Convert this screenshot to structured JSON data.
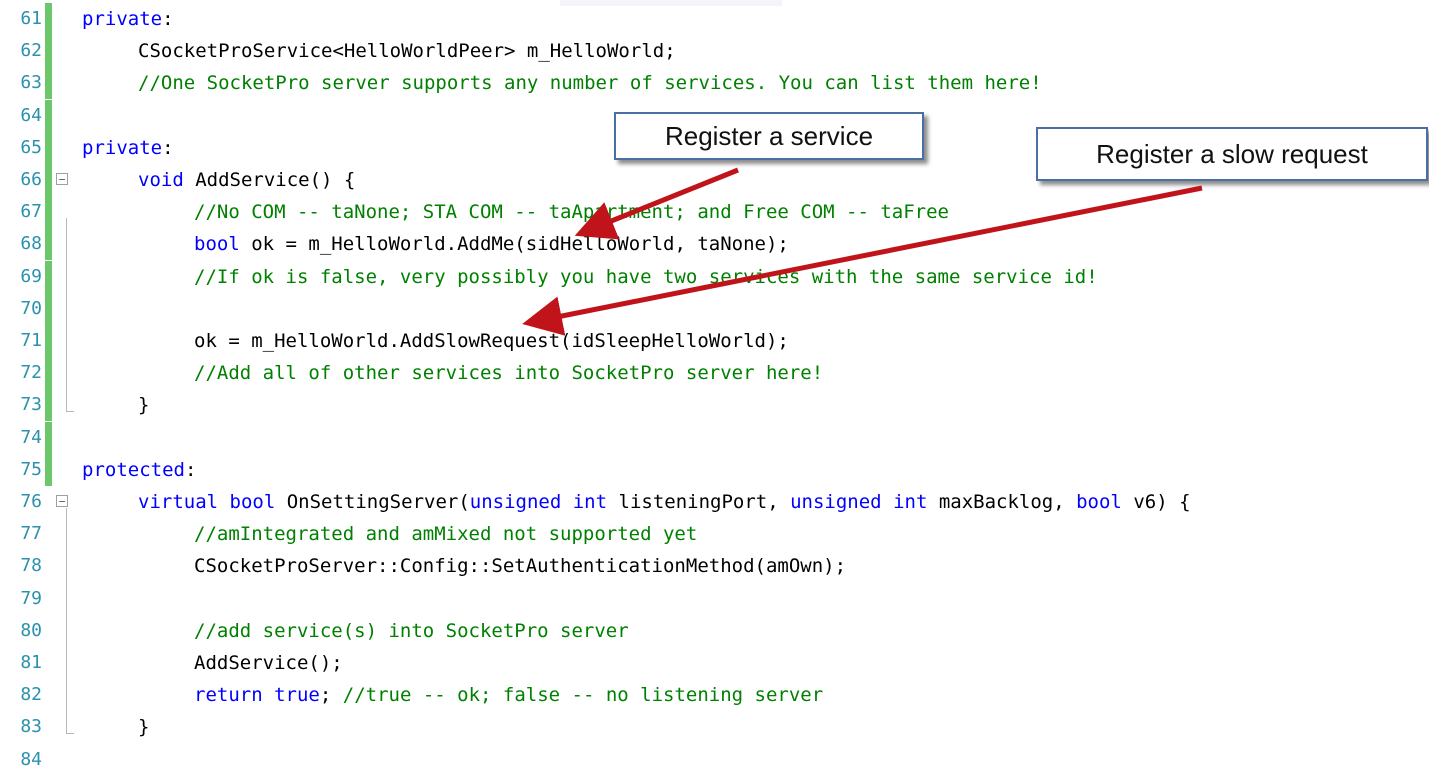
{
  "code_lines": [
    {
      "num": "61",
      "changed": true,
      "fold": "",
      "indent": 0,
      "segments": [
        {
          "t": "private",
          "c": "kw"
        },
        {
          "t": ":",
          "c": ""
        }
      ]
    },
    {
      "num": "62",
      "changed": true,
      "fold": "",
      "indent": 1,
      "segments": [
        {
          "t": "CSocketProService<HelloWorldPeer> m_HelloWorld;",
          "c": ""
        }
      ]
    },
    {
      "num": "63",
      "changed": true,
      "fold": "",
      "indent": 1,
      "segments": [
        {
          "t": "//One SocketPro server supports any number of services. You can list them here!",
          "c": "cm"
        }
      ]
    },
    {
      "num": "64",
      "changed": true,
      "fold": "",
      "indent": 0,
      "segments": []
    },
    {
      "num": "65",
      "changed": true,
      "fold": "",
      "indent": 0,
      "segments": [
        {
          "t": "private",
          "c": "kw"
        },
        {
          "t": ":",
          "c": ""
        }
      ]
    },
    {
      "num": "66",
      "changed": true,
      "fold": "−",
      "indent": 1,
      "segments": [
        {
          "t": "void",
          "c": "kw"
        },
        {
          "t": " AddService() {",
          "c": ""
        }
      ]
    },
    {
      "num": "67",
      "changed": true,
      "fold": "",
      "indent": 2,
      "segments": [
        {
          "t": "//No COM -- taNone; STA COM -- taApartment; and Free COM -- taFree",
          "c": "cm"
        }
      ]
    },
    {
      "num": "68",
      "changed": true,
      "fold": "",
      "indent": 2,
      "segments": [
        {
          "t": "bool",
          "c": "kw"
        },
        {
          "t": " ok = m_HelloWorld.AddMe(sidHelloWorld, taNone);",
          "c": ""
        }
      ]
    },
    {
      "num": "69",
      "changed": true,
      "fold": "",
      "indent": 2,
      "segments": [
        {
          "t": "//If ok is false, very possibly you have two services with the same service id!",
          "c": "cm"
        }
      ]
    },
    {
      "num": "70",
      "changed": true,
      "fold": "",
      "indent": 0,
      "segments": []
    },
    {
      "num": "71",
      "changed": true,
      "fold": "",
      "indent": 2,
      "segments": [
        {
          "t": "ok = m_HelloWorld.AddSlowRequest(idSleepHelloWorld);",
          "c": ""
        }
      ]
    },
    {
      "num": "72",
      "changed": true,
      "fold": "",
      "indent": 2,
      "segments": [
        {
          "t": "//Add all of other services into SocketPro server here!",
          "c": "cm"
        }
      ]
    },
    {
      "num": "73",
      "changed": true,
      "fold": "",
      "indent": 1,
      "segments": [
        {
          "t": "}",
          "c": ""
        }
      ]
    },
    {
      "num": "74",
      "changed": true,
      "fold": "",
      "indent": 0,
      "segments": []
    },
    {
      "num": "75",
      "changed": true,
      "fold": "",
      "indent": 0,
      "segments": [
        {
          "t": "protected",
          "c": "kw"
        },
        {
          "t": ":",
          "c": ""
        }
      ]
    },
    {
      "num": "76",
      "changed": false,
      "fold": "−",
      "indent": 1,
      "segments": [
        {
          "t": "virtual",
          "c": "kw"
        },
        {
          "t": " ",
          "c": ""
        },
        {
          "t": "bool",
          "c": "kw"
        },
        {
          "t": " OnSettingServer(",
          "c": ""
        },
        {
          "t": "unsigned",
          "c": "kw"
        },
        {
          "t": " ",
          "c": ""
        },
        {
          "t": "int",
          "c": "kw"
        },
        {
          "t": " listeningPort, ",
          "c": ""
        },
        {
          "t": "unsigned",
          "c": "kw"
        },
        {
          "t": " ",
          "c": ""
        },
        {
          "t": "int",
          "c": "kw"
        },
        {
          "t": " maxBacklog, ",
          "c": ""
        },
        {
          "t": "bool",
          "c": "kw"
        },
        {
          "t": " v6) {",
          "c": ""
        }
      ]
    },
    {
      "num": "77",
      "changed": false,
      "fold": "",
      "indent": 2,
      "segments": [
        {
          "t": "//amIntegrated and amMixed not supported yet",
          "c": "cm"
        }
      ]
    },
    {
      "num": "78",
      "changed": false,
      "fold": "",
      "indent": 2,
      "segments": [
        {
          "t": "CSocketProServer::Config::SetAuthenticationMethod(amOwn);",
          "c": ""
        }
      ]
    },
    {
      "num": "79",
      "changed": false,
      "fold": "",
      "indent": 0,
      "segments": []
    },
    {
      "num": "80",
      "changed": false,
      "fold": "",
      "indent": 2,
      "segments": [
        {
          "t": "//add service(s) into SocketPro server",
          "c": "cm"
        }
      ]
    },
    {
      "num": "81",
      "changed": false,
      "fold": "",
      "indent": 2,
      "segments": [
        {
          "t": "AddService();",
          "c": ""
        }
      ]
    },
    {
      "num": "82",
      "changed": false,
      "fold": "",
      "indent": 2,
      "segments": [
        {
          "t": "return",
          "c": "kw"
        },
        {
          "t": " ",
          "c": ""
        },
        {
          "t": "true",
          "c": "kw"
        },
        {
          "t": "; ",
          "c": ""
        },
        {
          "t": "//true -- ok; false -- no listening server",
          "c": "cm"
        }
      ]
    },
    {
      "num": "83",
      "changed": false,
      "fold": "",
      "indent": 1,
      "segments": [
        {
          "t": "}",
          "c": ""
        }
      ]
    },
    {
      "num": "84",
      "changed": false,
      "fold": "",
      "indent": 0,
      "segments": []
    }
  ],
  "callouts": {
    "register_service": "Register a service",
    "register_slow_request": "Register a slow request"
  },
  "colors": {
    "keyword": "#0000ff",
    "comment": "#008000",
    "line_number": "#2b91af",
    "change_bar": "#6cc76c",
    "arrow": "#c0141a",
    "callout_border": "#4a6fa3"
  }
}
